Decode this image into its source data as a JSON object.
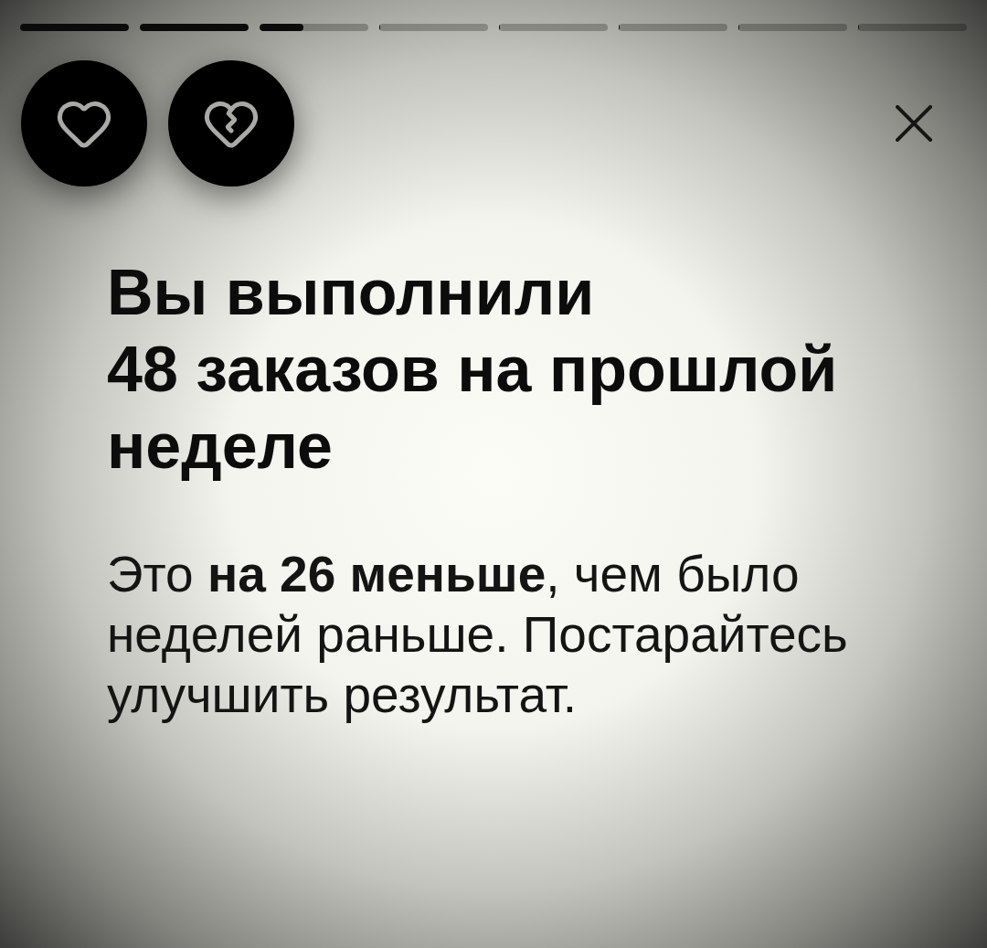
{
  "progress": [
    {
      "level": 1
    },
    {
      "level": 1
    },
    {
      "level": 0.4
    },
    {
      "level": 0
    },
    {
      "level": 0
    },
    {
      "level": 0
    },
    {
      "level": 0
    },
    {
      "level": 0
    }
  ],
  "actions": [
    {
      "kind": "like"
    },
    {
      "kind": "dislike"
    }
  ],
  "title": "Вы выполнили\n48 заказов на прошлой неделе",
  "message": "Это **на 26 меньше**, чем было неделей раньше. Постарайтесь улучшить результат."
}
